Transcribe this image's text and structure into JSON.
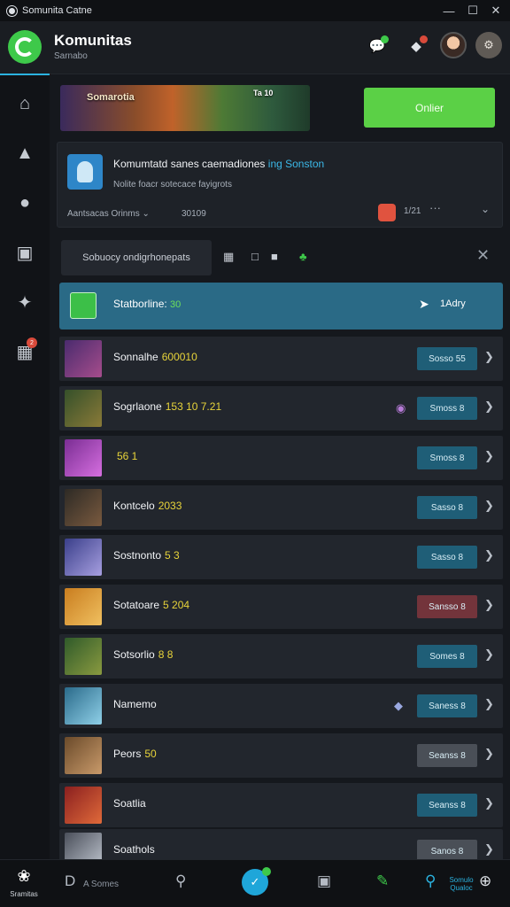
{
  "titlebar": {
    "title": "Somunita Catne",
    "minimize": "—",
    "maximize": "☐",
    "close": "✕"
  },
  "header": {
    "title": "Komunitas",
    "subtitle": "Sarnabo"
  },
  "sidebar": {
    "badge": "2"
  },
  "banner": {
    "text": "Somarotia",
    "text2": "Ta 10"
  },
  "cta": {
    "label": "Onlier"
  },
  "card": {
    "title": "Komumtatd sanes caemadiones",
    "title_highlight": "ing Sonston",
    "desc": "Nolite foacr sotecace fayigrots",
    "meta": "Aantsacas Orinms ⌄",
    "count": "30109",
    "num": "1/21",
    "more": "···",
    "chevron": "⌄"
  },
  "filter": {
    "label": "Sobuocy ondigrhonepats",
    "close": "✕"
  },
  "selected_row": {
    "label": "Statborline:",
    "value": "30",
    "action": "1Adry"
  },
  "rows": [
    {
      "name": "Sonnalhe",
      "value": "600010",
      "button": "Sosso 55"
    },
    {
      "name": "Sogrlaone",
      "value": "153 10 7.21",
      "button": "Smoss 8"
    },
    {
      "name": "",
      "value": "56 1",
      "button": "Smoss 8"
    },
    {
      "name": "Kontcelo",
      "value": "2033",
      "button": "Sasso 8"
    },
    {
      "name": "Sostnonto",
      "value": "5 3",
      "button": "Sasso 8"
    },
    {
      "name": "Sotatoare",
      "value": "5 204",
      "button": "Sansso 8"
    },
    {
      "name": "Sotsorlio",
      "value": "8 8",
      "button": "Somes 8"
    },
    {
      "name": "Namemo",
      "value": "",
      "button": "Saness 8"
    },
    {
      "name": "Peors",
      "value": "50",
      "button": "Seanss 8"
    },
    {
      "name": "Soatlia",
      "value": "",
      "button": "Seanss 8"
    },
    {
      "name": "Soathols",
      "value": "",
      "button": "Sanos 8"
    }
  ],
  "bottom": {
    "home_label": "Sramitas",
    "search_label": "A Somes",
    "right_label": "Somulo Qualoc"
  }
}
